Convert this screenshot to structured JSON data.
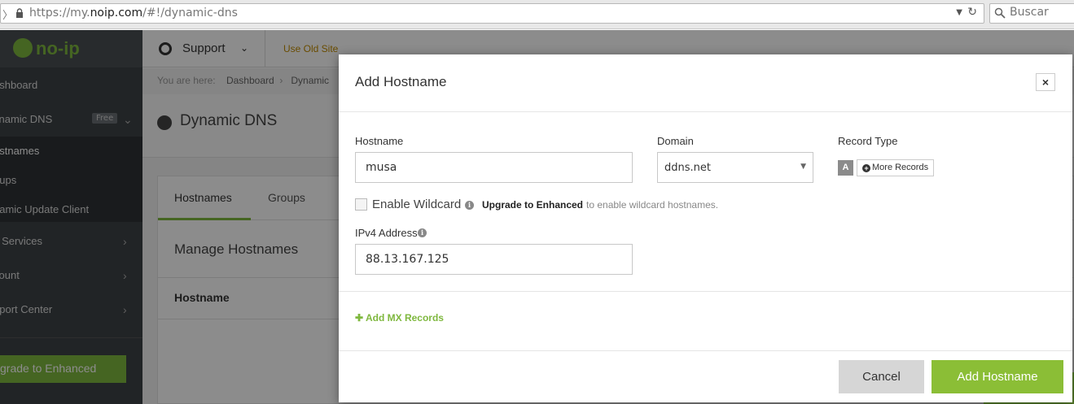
{
  "browser": {
    "url_prefix": "https://my.",
    "url_domain": "noip.com",
    "url_path": "/#!/dynamic-dns",
    "search_placeholder": "Buscar"
  },
  "logo": {
    "text": "no-ip"
  },
  "sidebar": {
    "items": [
      {
        "label": "ashboard"
      },
      {
        "label": "ynamic DNS",
        "badge": "Free"
      },
      {
        "label": "ostnames"
      },
      {
        "label": "oups"
      },
      {
        "label": "namic Update Client"
      },
      {
        "label": "y Services"
      },
      {
        "label": "count"
      },
      {
        "label": "pport Center"
      }
    ],
    "upgrade_label": "grade to Enhanced"
  },
  "topbar": {
    "support_label": "Support",
    "old_site_label": "Use Old Site"
  },
  "content": {
    "crumb_prefix": "You are here:",
    "crumb_dashboard": "Dashboard",
    "crumb_current": "Dynamic",
    "page_title": "Dynamic DNS",
    "tabs": [
      {
        "label": "Hostnames"
      },
      {
        "label": "Groups"
      }
    ],
    "manage_title": "Manage Hostnames",
    "table_header": "Hostname"
  },
  "modal": {
    "title": "Add Hostname",
    "close_label": "×",
    "hostname_label": "Hostname",
    "hostname_value": "musa",
    "domain_label": "Domain",
    "domain_value": "ddns.net",
    "record_type_label": "Record Type",
    "record_type_value": "A",
    "more_records_label": "More Records",
    "wildcard_label": "Enable Wildcard",
    "upgrade_link": "Upgrade to Enhanced",
    "upgrade_note": "to enable wildcard hostnames.",
    "ipv4_label": "IPv4 Address",
    "ipv4_value": "88.13.167.125",
    "add_mx_label": "Add MX Records",
    "cancel_label": "Cancel",
    "submit_label": "Add Hostname"
  },
  "colors": {
    "brand_green": "#7fb83f",
    "sidebar_bg": "#3d4246"
  }
}
